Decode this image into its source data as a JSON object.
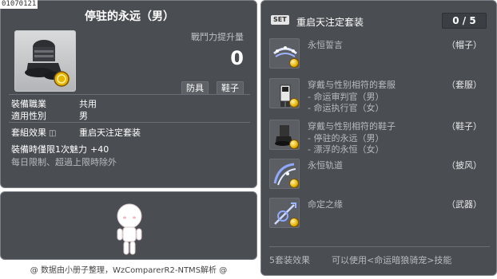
{
  "item_id": "01070121",
  "item": {
    "title": "停驻的永远（男）",
    "power_label": "戰鬥力提升量",
    "power_value": "0",
    "tags": [
      "防具",
      "鞋子"
    ],
    "requirements": [
      {
        "label": "裝備職業",
        "value": "共用"
      },
      {
        "label": "適用性別",
        "value": "男"
      }
    ],
    "set_effect_label": "套組效果",
    "set_effect_value": "重启天注定套装",
    "bonus_label": "裝備時僅限1次魅力",
    "bonus_value": "+40",
    "limit_text": "每日限制、超過上限時除外"
  },
  "footer": "@ 数据由小册子整理，WzComparerR2-NTMS解析 @",
  "set": {
    "badge": "SET",
    "name": "重启天注定套装",
    "count": "0 / 5",
    "items": [
      {
        "name": "永恒誓言",
        "type": "（帽子）",
        "subs": []
      },
      {
        "name": "穿戴与性别相符的套服",
        "type": "（套服）",
        "subs": [
          "- 命运审判官（男）",
          "- 命运执行官（女）"
        ]
      },
      {
        "name": "穿戴与性别相符的鞋子",
        "type": "（鞋子）",
        "subs": [
          "- 停驻的永远（男）",
          "- 漂浮的永恒（女）"
        ]
      },
      {
        "name": "永恒轨道",
        "type": "（披风）",
        "subs": []
      },
      {
        "name": "命定之缘",
        "type": "（武器）",
        "subs": []
      }
    ],
    "effect_label": "5套装效果",
    "effect_text": "可以使用<命运暗狼骑宠>技能"
  },
  "colors": {
    "panel_bg": "#4a4d52",
    "panel_border": "#7b7f86",
    "muted_text": "#b7bbc0",
    "coin": "#e7b400"
  },
  "icons": {
    "item_icon": "black-shoes-icon",
    "set_icons": [
      "star-hat-icon",
      "suit-icon",
      "shoes-icon",
      "cape-icon",
      "weapon-icon"
    ],
    "lock": "lock-icon",
    "coin": "gold-coin-icon"
  }
}
